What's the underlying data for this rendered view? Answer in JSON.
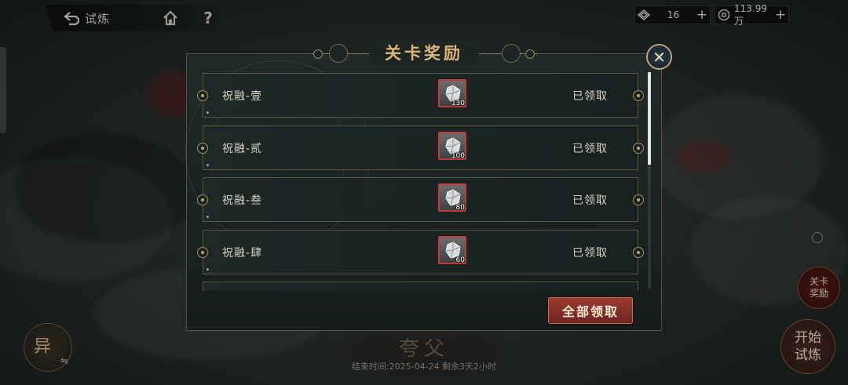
{
  "nav": {
    "back_label": "试炼",
    "help_label": "?"
  },
  "resources": {
    "jade_value": "16",
    "coin_value": "113.99万",
    "plus_label": "+"
  },
  "scene": {
    "stage_name": "夸父",
    "end_time_text": "结束时间:2025-04-24 剩余3天2小时",
    "yi_label": "异",
    "swap_label": "⇋",
    "side_reward_label": "关卡奖励",
    "start_label": "开始试炼"
  },
  "modal": {
    "title": "关卡奖励",
    "close_label": "✕",
    "rows": [
      {
        "name": "祝融-壹",
        "reward_icon": "gem-crystal-icon",
        "reward_count": "130",
        "status": "已领取"
      },
      {
        "name": "祝融-贰",
        "reward_icon": "gem-crystal-icon",
        "reward_count": "100",
        "status": "已领取"
      },
      {
        "name": "祝融-叁",
        "reward_icon": "gem-crystal-icon",
        "reward_count": "80",
        "status": "已领取"
      },
      {
        "name": "祝融-肆",
        "reward_icon": "gem-crystal-icon",
        "reward_count": "60",
        "status": "已领取"
      }
    ],
    "claim_all_label": "全部领取"
  },
  "colors": {
    "title_gold": "#d9b679",
    "claim_red": "#9d3a30",
    "reward_border": "#c4393a"
  }
}
